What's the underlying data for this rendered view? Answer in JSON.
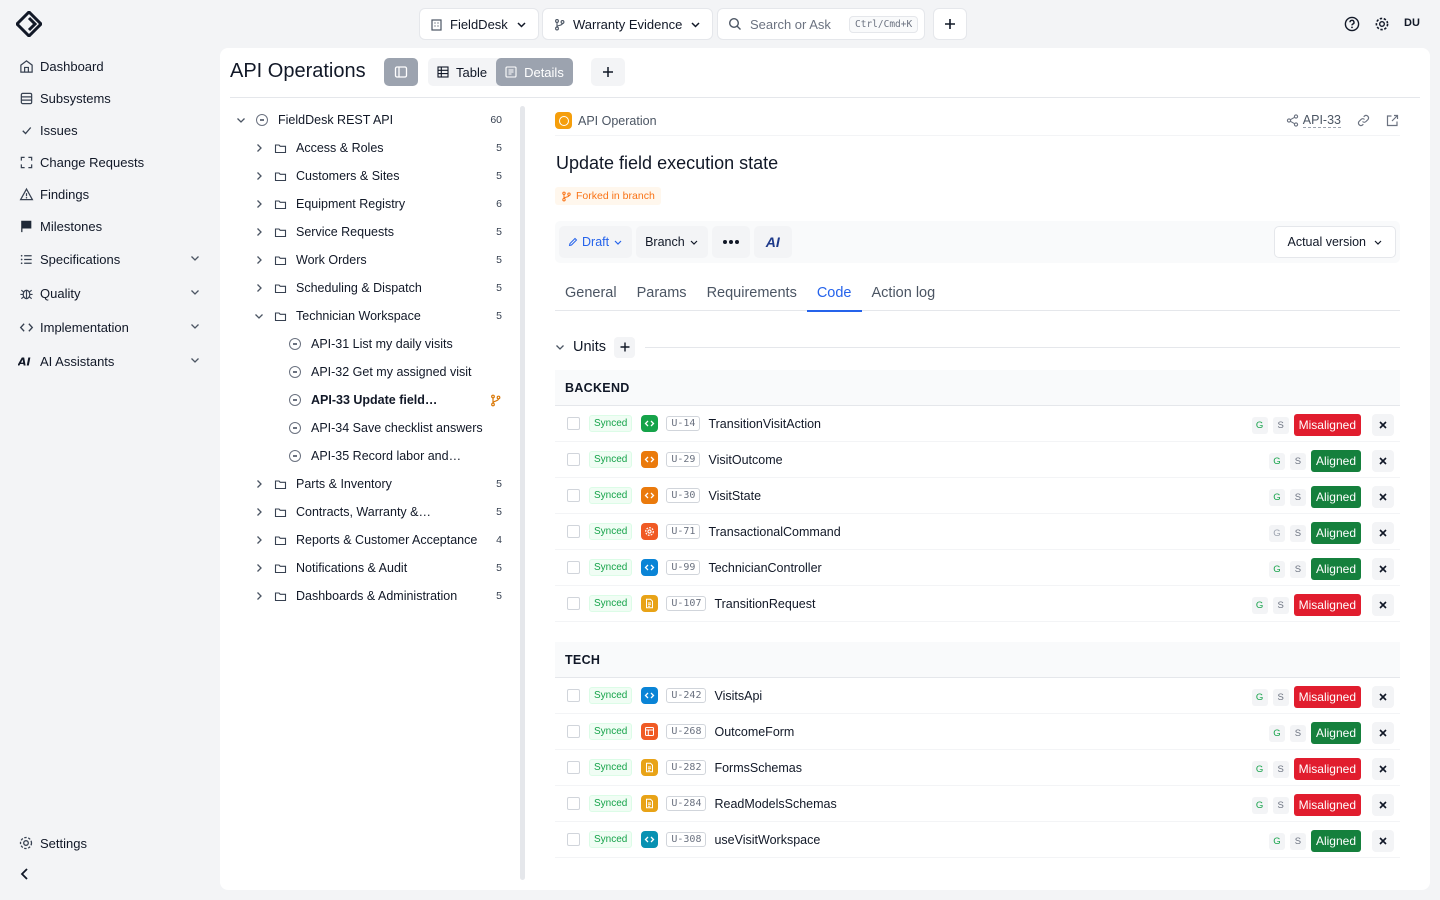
{
  "sidebar": {
    "items": [
      {
        "label": "Dashboard",
        "icon": "dashboard-icon",
        "expandable": false
      },
      {
        "label": "Subsystems",
        "icon": "subsystems-icon",
        "expandable": false
      },
      {
        "label": "Issues",
        "icon": "check-icon",
        "expandable": false
      },
      {
        "label": "Change Requests",
        "icon": "change-request-icon",
        "expandable": false
      },
      {
        "label": "Findings",
        "icon": "warning-icon",
        "expandable": false
      },
      {
        "label": "Milestones",
        "icon": "flag-icon",
        "expandable": false
      },
      {
        "label": "Specifications",
        "icon": "list-icon",
        "expandable": true
      },
      {
        "label": "Quality",
        "icon": "bug-icon",
        "expandable": true
      },
      {
        "label": "Implementation",
        "icon": "code-icon",
        "expandable": true
      },
      {
        "label": "AI Assistants",
        "icon": "ai-icon",
        "expandable": true
      }
    ],
    "settings_label": "Settings"
  },
  "topbar": {
    "project": "FieldDesk",
    "branch": "Warranty Evidence",
    "search_placeholder": "Search or Ask",
    "search_shortcut": "Ctrl/Cmd+K",
    "avatar_initials": "DU"
  },
  "page": {
    "title": "API Operations",
    "view_table": "Table",
    "view_details": "Details"
  },
  "tree": {
    "root": {
      "label": "FieldDesk REST API",
      "count": "60"
    },
    "groups": [
      {
        "label": "Access & Roles",
        "count": "5"
      },
      {
        "label": "Customers & Sites",
        "count": "5"
      },
      {
        "label": "Equipment Registry",
        "count": "6"
      },
      {
        "label": "Service Requests",
        "count": "5"
      },
      {
        "label": "Work Orders",
        "count": "5"
      },
      {
        "label": "Scheduling & Dispatch",
        "count": "5"
      }
    ],
    "open_group": {
      "label": "Technician Workspace",
      "count": "5"
    },
    "open_children": [
      {
        "label": "API-31 List my daily visits",
        "branch": false
      },
      {
        "label": "API-32 Get my assigned visit",
        "branch": false
      },
      {
        "label": "API-33 Update field…",
        "branch": true
      },
      {
        "label": "API-34 Save checklist answers",
        "branch": false
      },
      {
        "label": "API-35 Record labor and…",
        "branch": false
      }
    ],
    "groups_after": [
      {
        "label": "Parts & Inventory",
        "count": "5"
      },
      {
        "label": "Contracts, Warranty &…",
        "count": "5"
      },
      {
        "label": "Reports & Customer Acceptance",
        "count": "4"
      },
      {
        "label": "Notifications & Audit",
        "count": "5"
      },
      {
        "label": "Dashboards & Administration",
        "count": "5"
      }
    ]
  },
  "detail": {
    "type_label": "API Operation",
    "id": "API-33",
    "title": "Update field execution state",
    "fork_badge": "Forked in branch",
    "status": "Draft",
    "branch_btn": "Branch",
    "ai_btn": "AI",
    "version": "Actual version",
    "tabs": [
      "General",
      "Params",
      "Requirements",
      "Code",
      "Action log"
    ],
    "active_tab": "Code",
    "units_label": "Units"
  },
  "unit_groups": [
    {
      "name": "BACKEND",
      "units": [
        {
          "sync": "Synced",
          "kind_color": "#16a34a",
          "kind_icon": "code-icon",
          "id": "U-14",
          "name": "TransitionVisitAction",
          "g_active": true,
          "status": "Misaligned"
        },
        {
          "sync": "Synced",
          "kind_color": "#ea7a0c",
          "kind_icon": "code-icon",
          "id": "U-29",
          "name": "VisitOutcome",
          "g_active": true,
          "status": "Aligned"
        },
        {
          "sync": "Synced",
          "kind_color": "#ea7a0c",
          "kind_icon": "code-icon",
          "id": "U-30",
          "name": "VisitState",
          "g_active": true,
          "status": "Aligned"
        },
        {
          "sync": "Synced",
          "kind_color": "#f05a24",
          "kind_icon": "gear-icon",
          "id": "U-71",
          "name": "TransactionalCommand",
          "g_active": false,
          "status": "Aligned"
        },
        {
          "sync": "Synced",
          "kind_color": "#0a84d6",
          "kind_icon": "code-icon",
          "id": "U-99",
          "name": "TechnicianController",
          "g_active": true,
          "status": "Aligned"
        },
        {
          "sync": "Synced",
          "kind_color": "#e8a317",
          "kind_icon": "document-icon",
          "id": "U-107",
          "name": "TransitionRequest",
          "g_active": true,
          "status": "Misaligned"
        }
      ]
    },
    {
      "name": "TECH",
      "units": [
        {
          "sync": "Synced",
          "kind_color": "#0a84d6",
          "kind_icon": "code-icon",
          "id": "U-242",
          "name": "VisitsApi",
          "g_active": true,
          "status": "Misaligned"
        },
        {
          "sync": "Synced",
          "kind_color": "#f05a24",
          "kind_icon": "form-icon",
          "id": "U-268",
          "name": "OutcomeForm",
          "g_active": true,
          "status": "Aligned"
        },
        {
          "sync": "Synced",
          "kind_color": "#e8a317",
          "kind_icon": "document-icon",
          "id": "U-282",
          "name": "FormsSchemas",
          "g_active": true,
          "status": "Misaligned"
        },
        {
          "sync": "Synced",
          "kind_color": "#e8a317",
          "kind_icon": "document-icon",
          "id": "U-284",
          "name": "ReadModelsSchemas",
          "g_active": true,
          "status": "Misaligned"
        },
        {
          "sync": "Synced",
          "kind_color": "#0891b2",
          "kind_icon": "code-icon",
          "id": "U-308",
          "name": "useVisitWorkspace",
          "g_active": true,
          "status": "Aligned"
        }
      ]
    }
  ],
  "badge_g": "G",
  "badge_s": "S"
}
